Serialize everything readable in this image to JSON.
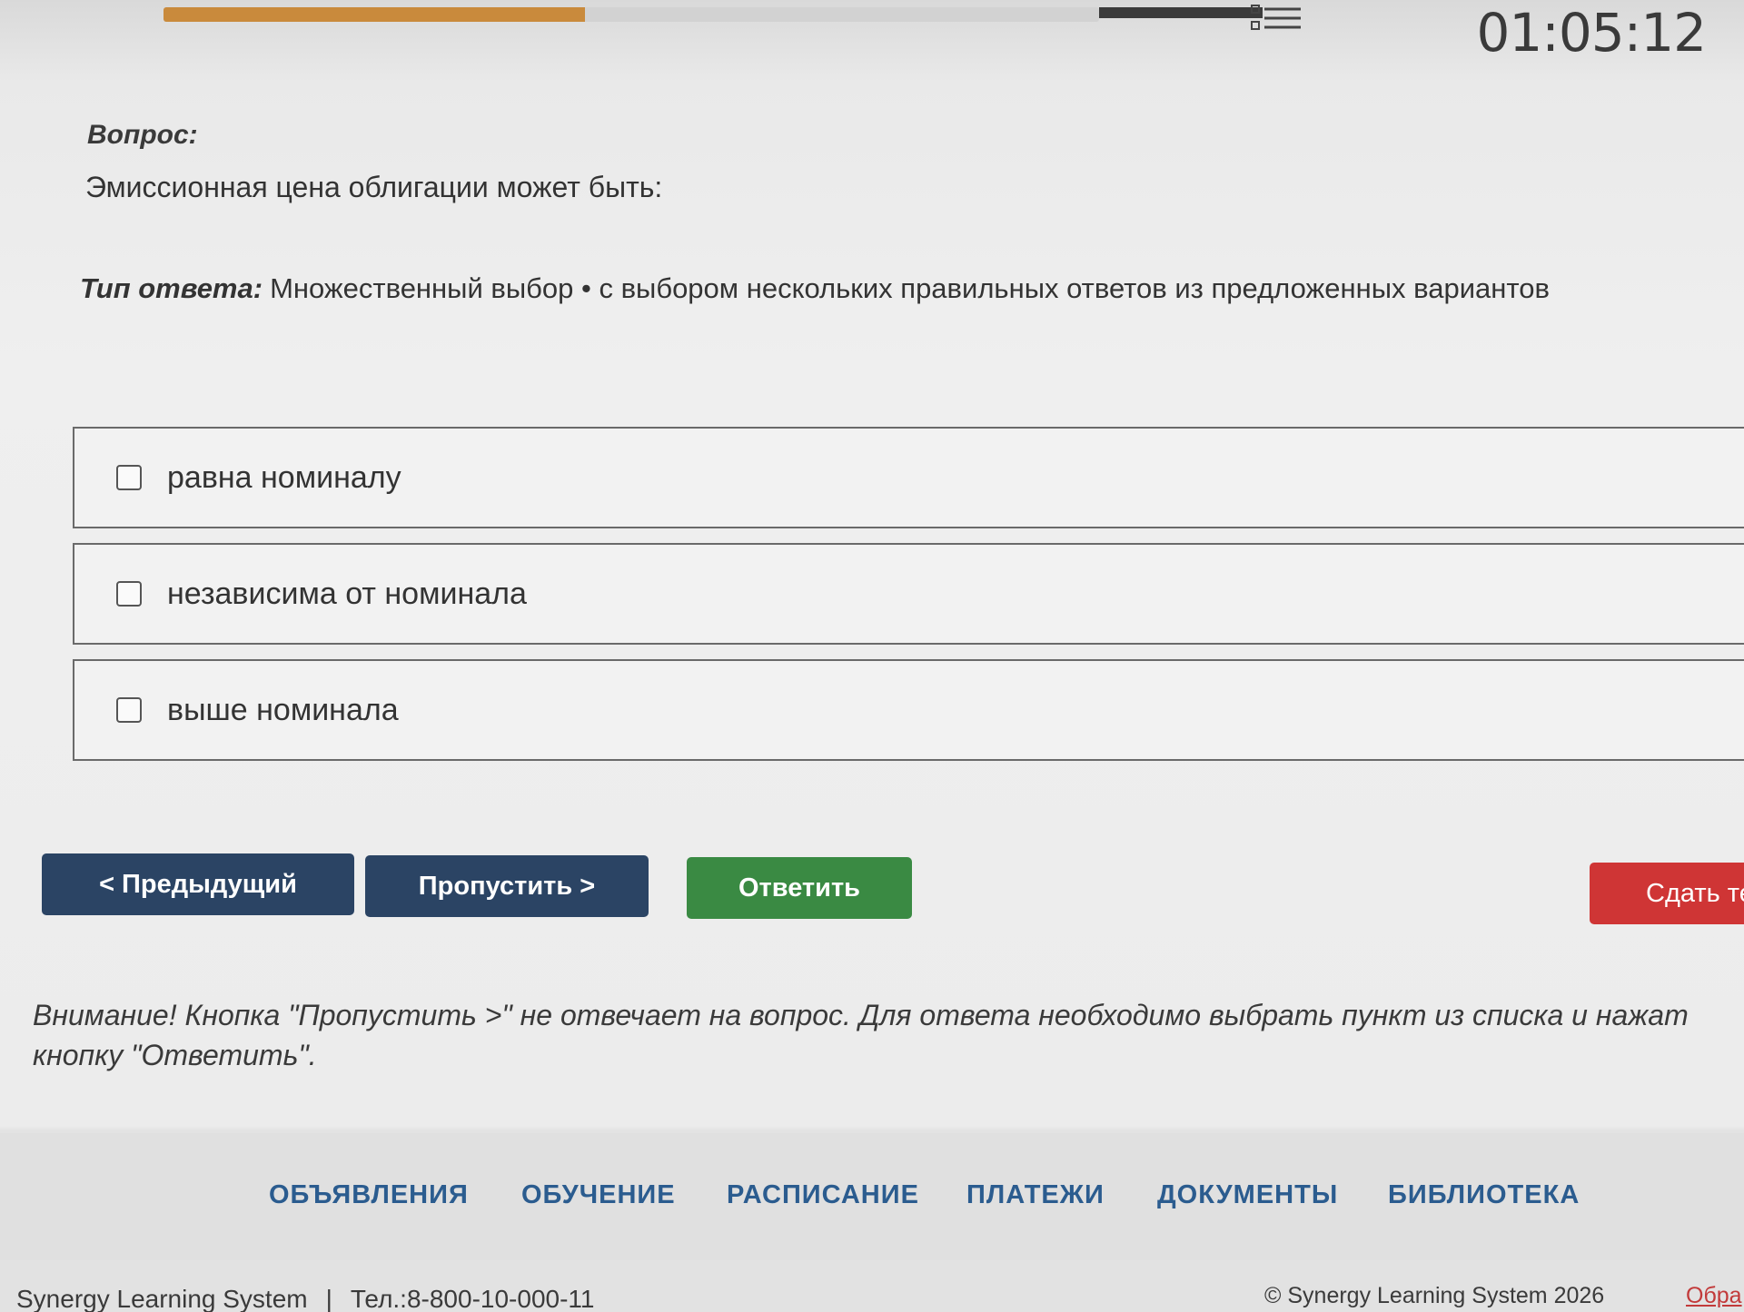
{
  "header": {
    "progress": 0.45,
    "timer": "01:05:12"
  },
  "question": {
    "label": "Вопрос:",
    "text": "Эмиссионная цена облигации может быть:"
  },
  "answer_type": {
    "label": "Тип ответа:",
    "text": "Множественный выбор • с выбором нескольких правильных ответов из предложенных вариантов"
  },
  "options": [
    {
      "label": "равна номиналу",
      "checked": false
    },
    {
      "label": "независима от номинала",
      "checked": false
    },
    {
      "label": "выше номинала",
      "checked": false
    }
  ],
  "buttons": {
    "prev": "< Предыдущий",
    "skip": "Пропустить >",
    "answer": "Ответить",
    "submit": "Сдать те"
  },
  "warning": "Внимание! Кнопка \"Пропустить >\" не отвечает на вопрос. Для ответа необходимо выбрать пункт из списка и нажат\nкнопку \"Ответить\".",
  "nav": {
    "items": [
      "ОБЪЯВЛЕНИЯ",
      "ОБУЧЕНИЕ",
      "РАСПИСАНИЕ",
      "ПЛАТЕЖИ",
      "ДОКУМЕНТЫ",
      "БИБЛИОТЕКА"
    ]
  },
  "footer": {
    "org": "Synergy Learning System",
    "phone": "Тел.:8-800-10-000-11",
    "copyright": "© Synergy Learning System 2026",
    "link": "Обра"
  },
  "colors": {
    "primary_button": "#2b4464",
    "answer_button": "#3a8a43",
    "submit_button": "#cf3535",
    "nav_link": "#2b5c8f",
    "progress": "#c98a3c"
  }
}
